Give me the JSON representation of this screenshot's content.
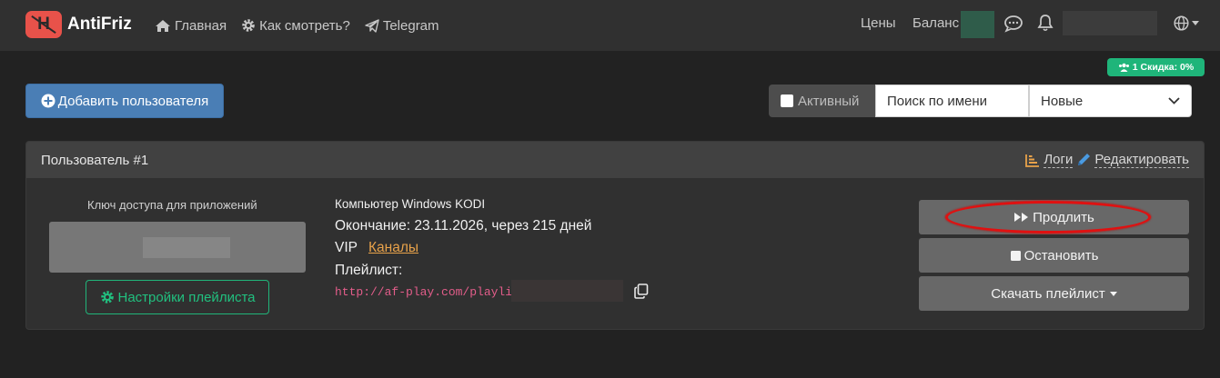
{
  "nav": {
    "brand_logo_letter": "H",
    "brand": "AntiFriz",
    "links": [
      {
        "label": "Главная",
        "icon": "home-icon"
      },
      {
        "label": "Как смотреть?",
        "icon": "gear-icon"
      },
      {
        "label": "Telegram",
        "icon": "paper-plane-icon"
      }
    ],
    "prices": "Цены",
    "balance": "Баланс"
  },
  "discount_badge": "1 Скидка: 0%",
  "toolbar": {
    "add_user": "Добавить пользователя",
    "active_label": "Активный",
    "search_placeholder": "Поиск по имени",
    "sort_value": "Новые"
  },
  "card": {
    "title": "Пользователь #1",
    "logs": "Логи",
    "edit": "Редактировать",
    "access_key_label": "Ключ доступа для приложений",
    "playlist_settings": "Настройки плейлиста",
    "device": "Компьютер Windows KODI",
    "expiry": "Окончание: 23.11.2026, через 215 дней",
    "plan": "VIP",
    "channels": "Каналы",
    "playlist_label": "Плейлист:",
    "playlist_url": "http://af-play.com/playli",
    "renew": "Продлить",
    "stop": "Остановить",
    "download": "Скачать плейлист"
  },
  "colors": {
    "accent_blue": "#4a7eb5",
    "success_green": "#1fb57a",
    "link_orange": "#e8a24a",
    "highlight_red": "#e01010"
  }
}
